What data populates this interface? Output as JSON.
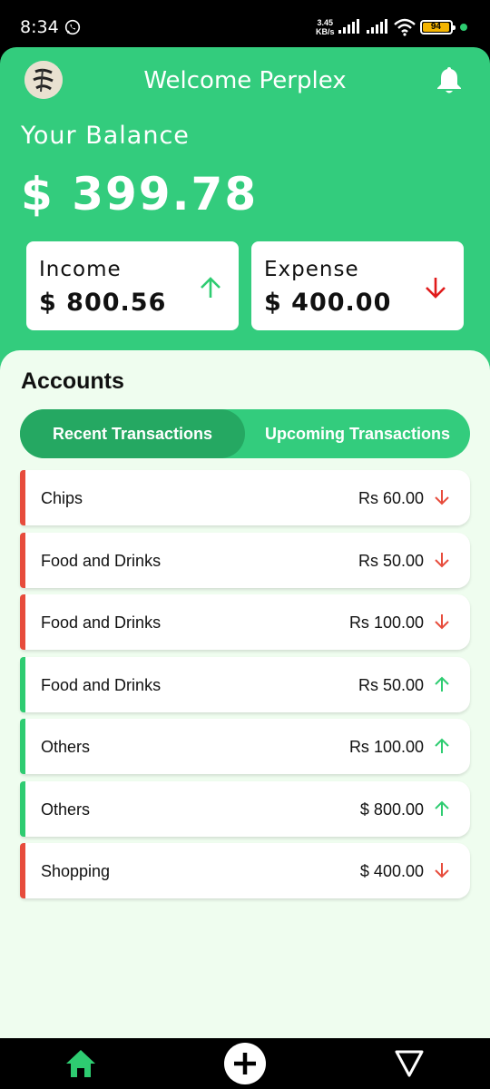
{
  "status_bar": {
    "time": "8:34",
    "speed_value": "3.45",
    "speed_unit": "KB/s",
    "battery": "94"
  },
  "header": {
    "welcome": "Welcome Perplex",
    "balance_label": "Your Balance",
    "balance_value": "$ 399.78"
  },
  "summary": {
    "income_label": "Income",
    "income_value": "$ 800.56",
    "expense_label": "Expense",
    "expense_value": "$ 400.00"
  },
  "accounts": {
    "title": "Accounts",
    "tabs": [
      {
        "label": "Recent Transactions",
        "active": true
      },
      {
        "label": "Upcoming Transactions",
        "active": false
      }
    ],
    "transactions": [
      {
        "name": "Chips",
        "amount": "Rs 60.00",
        "type": "expense"
      },
      {
        "name": "Food and Drinks",
        "amount": "Rs 50.00",
        "type": "expense"
      },
      {
        "name": "Food and Drinks",
        "amount": "Rs 100.00",
        "type": "expense"
      },
      {
        "name": "Food and Drinks",
        "amount": "Rs 50.00",
        "type": "income"
      },
      {
        "name": "Others",
        "amount": "Rs 100.00",
        "type": "income"
      },
      {
        "name": "Others",
        "amount": "$ 800.00",
        "type": "income"
      },
      {
        "name": "Shopping",
        "amount": "$ 400.00",
        "type": "expense"
      }
    ]
  },
  "colors": {
    "primary": "#33cc7d",
    "primary_dark": "#25a862",
    "panel_bg": "#effdef",
    "income": "#2ecc71",
    "expense": "#e74c3c",
    "expense_card_arrow": "#e01b1b"
  },
  "icons": {
    "notification": "bell-icon",
    "income": "arrow-up-icon",
    "expense": "arrow-down-icon",
    "nav_home": "home-icon",
    "nav_add": "plus-circle-icon",
    "nav_back": "triangle-back-icon"
  }
}
